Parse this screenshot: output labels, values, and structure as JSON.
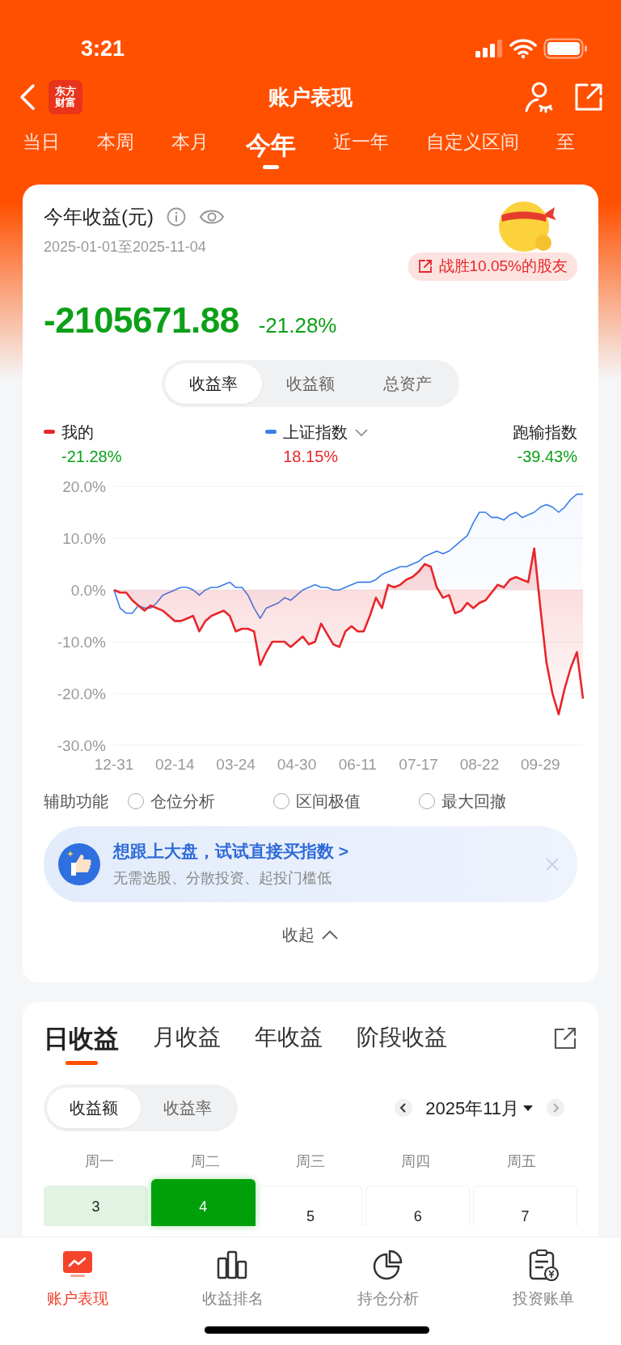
{
  "status_bar": {
    "time": "3:21"
  },
  "header": {
    "logo_lines": [
      "东方",
      "财富"
    ],
    "title": "账户表现"
  },
  "period_tabs": [
    {
      "label": "当日",
      "selected": false
    },
    {
      "label": "本周",
      "selected": false
    },
    {
      "label": "本月",
      "selected": false
    },
    {
      "label": "今年",
      "selected": true
    },
    {
      "label": "近一年",
      "selected": false
    },
    {
      "label": "自定义区间",
      "selected": false
    },
    {
      "label": "至",
      "selected": false
    }
  ],
  "summary": {
    "title": "今年收益(元)",
    "date_range": "2025-01-01至2025-11-04",
    "badge": "战胜10.05%的股友",
    "amount": "-2105671.88",
    "return": "-21.28%",
    "gain": false
  },
  "metric_tabs": [
    {
      "label": "收益率",
      "selected": true
    },
    {
      "label": "收益额",
      "selected": false
    },
    {
      "label": "总资产",
      "selected": false
    }
  ],
  "legend": [
    {
      "kind": "series",
      "label": "我的",
      "value": "-21.28%",
      "gain": false,
      "color": "#e8262b"
    },
    {
      "kind": "dropdown",
      "label": "上证指数",
      "value": "18.15%",
      "gain": true,
      "color": "#3a7ee8"
    },
    {
      "kind": "plain",
      "label": "跑输指数",
      "value": "-39.43%",
      "gain": false
    }
  ],
  "chart_data": {
    "type": "area",
    "categories": [
      "12-31",
      null,
      null,
      null,
      null,
      null,
      null,
      null,
      null,
      null,
      "02-14",
      null,
      null,
      null,
      null,
      null,
      null,
      null,
      null,
      null,
      "03-24",
      null,
      null,
      null,
      null,
      null,
      null,
      null,
      null,
      null,
      "04-30",
      null,
      null,
      null,
      null,
      null,
      null,
      null,
      null,
      null,
      "06-11",
      null,
      null,
      null,
      null,
      null,
      null,
      null,
      null,
      null,
      "07-17",
      null,
      null,
      null,
      null,
      null,
      null,
      null,
      null,
      null,
      "08-22",
      null,
      null,
      null,
      null,
      null,
      null,
      null,
      null,
      null,
      "09-29",
      null,
      null,
      null,
      null,
      null,
      null,
      null
    ],
    "series": [
      {
        "color": "#e8262b",
        "values": [
          0,
          -0.5,
          -0.5,
          -2,
          -3,
          -4,
          -3,
          -3.5,
          -4,
          -5,
          -6,
          -6,
          -5.5,
          -5,
          -8,
          -6,
          -5,
          -4.5,
          -4,
          -5,
          -8,
          -7.5,
          -7.5,
          -8,
          -14.5,
          -12,
          -10,
          -10,
          -10,
          -11,
          -10,
          -9,
          -10.5,
          -10,
          -6.5,
          -8.5,
          -10.5,
          -11,
          -8,
          -7,
          -8,
          -8,
          -5,
          -1.5,
          -3.5,
          1,
          0.5,
          1,
          2,
          2.5,
          3.5,
          5,
          4.5,
          0.5,
          -1.5,
          -1,
          -4.5,
          -4,
          -2.5,
          -3.5,
          -2.5,
          -2,
          -0.5,
          1,
          0.5,
          2,
          2.5,
          2,
          1.5,
          8,
          -3.5,
          -14,
          -20,
          -24,
          -19,
          -15,
          -12,
          -21
        ]
      },
      {
        "color": "#3a7ee8",
        "values": [
          0,
          -3.5,
          -4.5,
          -4.5,
          -3,
          -3.5,
          -3.5,
          -2.5,
          -1,
          -0.5,
          0,
          0.5,
          0.5,
          0,
          -1,
          0,
          0.5,
          0.5,
          1,
          1.5,
          0.5,
          0.5,
          -1,
          -3.5,
          -5.5,
          -3.5,
          -3,
          -2.5,
          -1.5,
          -2,
          -1,
          0,
          0.5,
          1,
          0.5,
          0.5,
          0,
          0,
          0.5,
          1,
          1.5,
          1.5,
          1.5,
          2,
          3,
          3.5,
          4,
          4.5,
          4.5,
          5,
          5.5,
          6.5,
          7,
          7.5,
          7,
          7.5,
          8.5,
          9.5,
          10.5,
          13,
          15,
          15,
          14,
          14,
          13.5,
          14.5,
          15,
          14,
          14.5,
          15,
          16,
          16.5,
          16,
          15,
          16,
          17.5,
          18.5,
          18.5
        ]
      }
    ],
    "ylim": [
      -30,
      20
    ],
    "grid": true,
    "yticks": [
      {
        "value": 20,
        "label": "20.0%"
      },
      {
        "value": 10,
        "label": "10.0%"
      },
      {
        "value": 0,
        "label": "0.0%"
      },
      {
        "value": -10,
        "label": "-10.0%"
      },
      {
        "value": -20,
        "label": "-20.0%"
      },
      {
        "value": -30,
        "label": "-30.0%"
      }
    ]
  },
  "aux": {
    "label": "辅助功能",
    "options": [
      {
        "label": "仓位分析",
        "checked": false
      },
      {
        "label": "区间极值",
        "checked": false
      },
      {
        "label": "最大回撤",
        "checked": false
      }
    ]
  },
  "banner": {
    "title": "想跟上大盘，试试直接买指数 >",
    "subtitle": "无需选股、分散投资、起投门槛低"
  },
  "collapse": "收起",
  "income_tabs": [
    {
      "label": "日收益",
      "selected": true
    },
    {
      "label": "月收益",
      "selected": false
    },
    {
      "label": "年收益",
      "selected": false
    },
    {
      "label": "阶段收益",
      "selected": false
    }
  ],
  "income_toggle": [
    {
      "label": "收益额",
      "selected": true
    },
    {
      "label": "收益率",
      "selected": false
    }
  ],
  "month": "2025年11月",
  "weekdays": [
    "周一",
    "周二",
    "周三",
    "周四",
    "周五"
  ],
  "days": [
    {
      "day": "3",
      "kind": "minor",
      "selected": false
    },
    {
      "day": "4",
      "kind": "major",
      "selected": true
    },
    {
      "day": "5",
      "kind": "empty",
      "selected": false
    },
    {
      "day": "6",
      "kind": "empty",
      "selected": false
    },
    {
      "day": "7",
      "kind": "empty",
      "selected": false
    }
  ],
  "bottom_nav": [
    {
      "label": "账户表现",
      "selected": true
    },
    {
      "label": "收益排名",
      "selected": false
    },
    {
      "label": "持仓分析",
      "selected": false
    },
    {
      "label": "投资账单",
      "selected": false
    }
  ]
}
